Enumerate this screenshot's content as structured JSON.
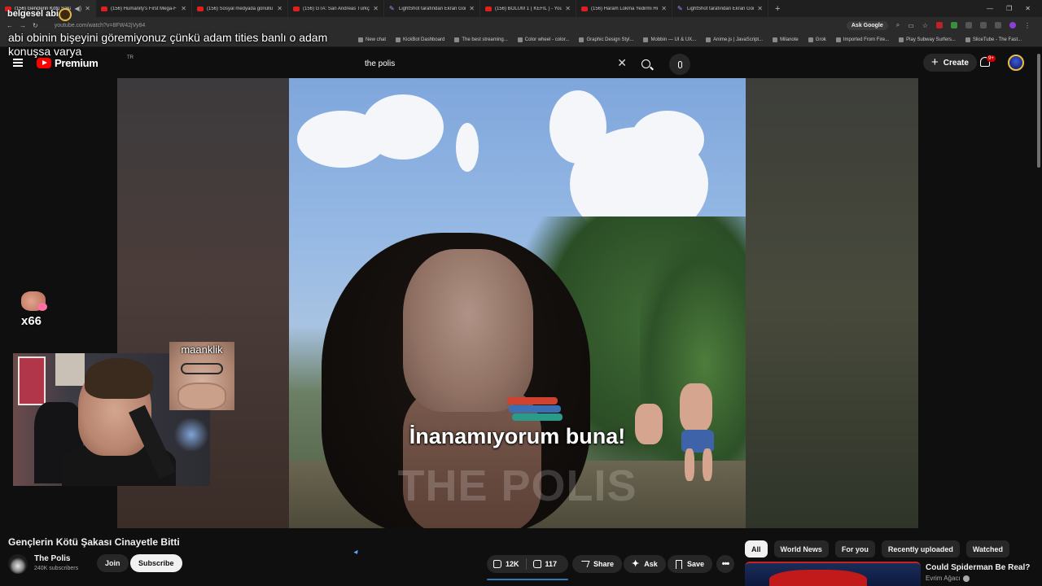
{
  "browser": {
    "tabs": [
      {
        "title": "(156) Gençlerin Kötü Şakası",
        "favicon": "youtube",
        "active": true
      },
      {
        "title": "(156) Humanity's First Mega-F",
        "favicon": "youtube",
        "active": false
      },
      {
        "title": "(156) Sosyal medyada gönüllü",
        "favicon": "youtube",
        "active": false
      },
      {
        "title": "(156) GTA: San Andreas Türkçe",
        "favicon": "youtube",
        "active": false
      },
      {
        "title": "LightShot tarafından Ekran Gör",
        "favicon": "lightshot",
        "active": false
      },
      {
        "title": "(156) BÖLÜM 1 ( KEFİL ) - YouT",
        "favicon": "youtube",
        "active": false
      },
      {
        "title": "(156) Haram Lokma Yedirmi Hi",
        "favicon": "youtube",
        "active": false
      },
      {
        "title": "LightShot tarafından Ekran Gör",
        "favicon": "lightshot",
        "active": false
      }
    ],
    "new_tab": "+",
    "url": "youtube.com/watch?v=8FW42jVy84",
    "ask_google": "Ask Google",
    "bookmarks": [
      "New chat",
      "KickBot Dashboard",
      "The best streaming...",
      "Color wheel - color...",
      "Graphic Design Styl...",
      "Mobbin — UI & UX...",
      "Anime.js | JavaScript...",
      "Milanote",
      "Grok",
      "Imported From Fire...",
      "Play Subway Surfers...",
      "SliceTube - The Fast..."
    ]
  },
  "stream_overlay": {
    "username": "belgesel abi",
    "message": "abi obinin bişeyini göremiyonuz çünkü adam tities banlı o adam konuşsa varya",
    "emote_count": "x66",
    "guest_name": "maanklik"
  },
  "youtube": {
    "logo_text": "Premium",
    "country_code": "TR",
    "search_value": "the polis",
    "create_label": "Create",
    "notification_badge": "9+",
    "video": {
      "subtitle": "İnanamıyorum buna!",
      "watermark": "THE POLIS",
      "title": "Gençlerin Kötü Şakası Cinayetle Bitti"
    },
    "channel": {
      "name": "The Polis",
      "subscribers": "240K subscribers",
      "join_label": "Join",
      "subscribe_label": "Subscribe"
    },
    "actions": {
      "likes": "12K",
      "dislikes": "117",
      "share": "Share",
      "ask": "Ask",
      "save": "Save"
    },
    "chips": [
      "All",
      "World News",
      "For you",
      "Recently uploaded",
      "Watched"
    ],
    "recommendation": {
      "title": "Could Spiderman Be Real?",
      "channel": "Evrim Ağacı"
    }
  }
}
